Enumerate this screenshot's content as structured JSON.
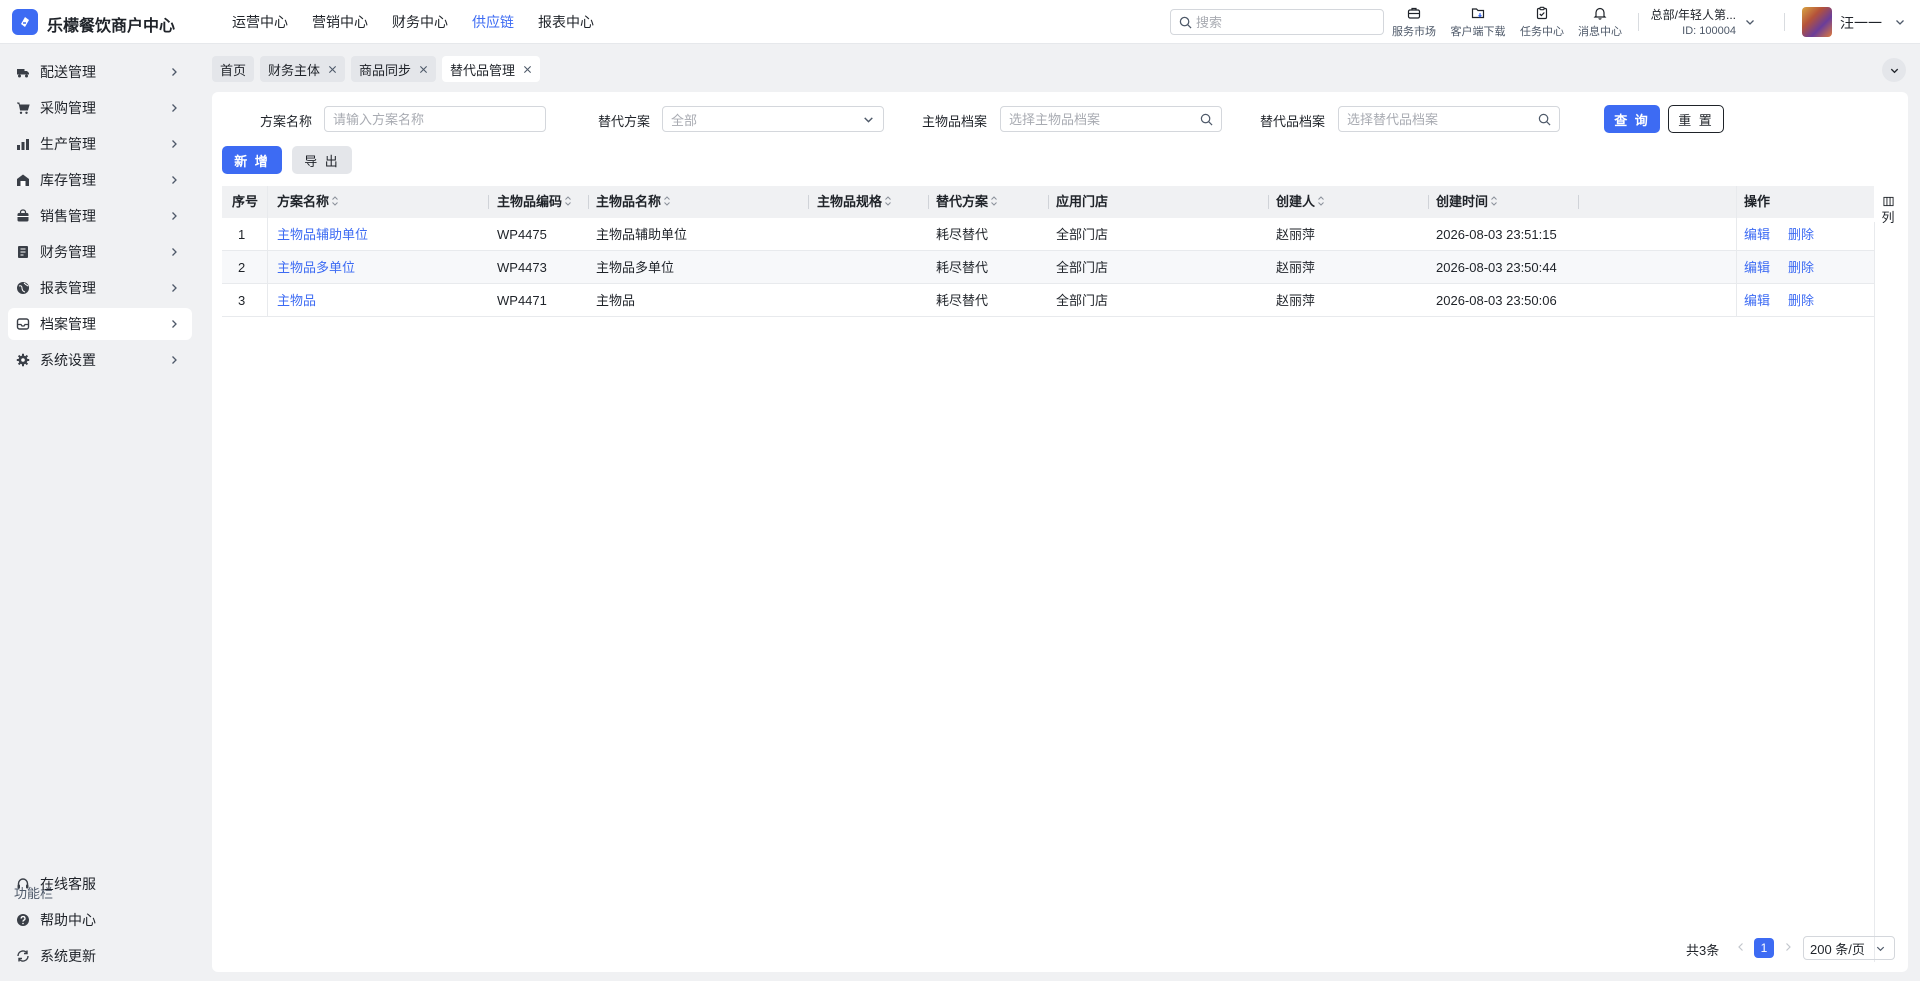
{
  "app": {
    "title": "乐檬餐饮商户中心",
    "top_nav": [
      {
        "label": "运营中心"
      },
      {
        "label": "营销中心"
      },
      {
        "label": "财务中心"
      },
      {
        "label": "供应链",
        "active": true
      },
      {
        "label": "报表中心"
      }
    ],
    "search_placeholder": "搜索",
    "tools": [
      {
        "label": "服务市场",
        "icon": "briefcase-icon"
      },
      {
        "label": "客户端下载",
        "icon": "folder-download-icon"
      },
      {
        "label": "任务中心",
        "icon": "clipboard-icon"
      },
      {
        "label": "消息中心",
        "icon": "bell-icon"
      }
    ],
    "org_name": "总部/年轻人第...",
    "org_id": "ID: 100004",
    "username": "汪一一"
  },
  "sidebar": {
    "items": [
      {
        "label": "配送管理",
        "icon": "truck-icon"
      },
      {
        "label": "采购管理",
        "icon": "cart-icon"
      },
      {
        "label": "生产管理",
        "icon": "factory-icon"
      },
      {
        "label": "库存管理",
        "icon": "warehouse-icon"
      },
      {
        "label": "销售管理",
        "icon": "bag-icon"
      },
      {
        "label": "财务管理",
        "icon": "ledger-icon"
      },
      {
        "label": "报表管理",
        "icon": "globe-icon"
      },
      {
        "label": "档案管理",
        "icon": "archive-icon",
        "active": true
      },
      {
        "label": "系统设置",
        "icon": "gear-icon"
      }
    ],
    "func_title": "功能栏",
    "func_items": [
      {
        "label": "在线客服",
        "icon": "headset-icon"
      },
      {
        "label": "帮助中心",
        "icon": "help-icon"
      },
      {
        "label": "系统更新",
        "icon": "refresh-icon"
      }
    ]
  },
  "tabs": [
    {
      "label": "首页",
      "closable": false
    },
    {
      "label": "财务主体",
      "closable": true
    },
    {
      "label": "商品同步",
      "closable": true
    },
    {
      "label": "替代品管理",
      "closable": true,
      "active": true
    }
  ],
  "filters": {
    "plan_name_label": "方案名称",
    "plan_name_placeholder": "请输入方案名称",
    "plan_type_label": "替代方案",
    "plan_type_value": "全部",
    "main_item_label": "主物品档案",
    "main_item_placeholder": "选择主物品档案",
    "sub_item_label": "替代品档案",
    "sub_item_placeholder": "选择替代品档案",
    "query_label": "查 询",
    "reset_label": "重 置"
  },
  "actions": {
    "add_label": "新 增",
    "export_label": "导 出"
  },
  "table": {
    "columns": {
      "index": "序号",
      "plan_name": "方案名称",
      "main_code": "主物品编码",
      "main_name": "主物品名称",
      "main_spec": "主物品规格",
      "plan_type": "替代方案",
      "store": "应用门店",
      "creator": "创建人",
      "created_at": "创建时间",
      "ops": "操作"
    },
    "rows": [
      {
        "index": "1",
        "plan_name": "主物品辅助单位",
        "main_code": "WP4475",
        "main_name": "主物品辅助单位",
        "main_spec": "",
        "plan_type": "耗尽替代",
        "store": "全部门店",
        "creator": "赵丽萍",
        "created_at": "2026-08-03 23:51:15",
        "edit": "编辑",
        "delete": "删除"
      },
      {
        "index": "2",
        "plan_name": "主物品多单位",
        "main_code": "WP4473",
        "main_name": "主物品多单位",
        "main_spec": "",
        "plan_type": "耗尽替代",
        "store": "全部门店",
        "creator": "赵丽萍",
        "created_at": "2026-08-03 23:50:44",
        "edit": "编辑",
        "delete": "删除"
      },
      {
        "index": "3",
        "plan_name": "主物品",
        "main_code": "WP4471",
        "main_name": "主物品",
        "main_spec": "",
        "plan_type": "耗尽替代",
        "store": "全部门店",
        "creator": "赵丽萍",
        "created_at": "2026-08-03 23:50:06",
        "edit": "编辑",
        "delete": "删除"
      }
    ],
    "column_config_label": "列"
  },
  "pagination": {
    "total": "共3条",
    "current_page": "1",
    "page_size": "200 条/页"
  },
  "colors": {
    "accent": "#3d6bf3",
    "sidebar_bg": "#f0f1f3",
    "text": "#1f2329"
  }
}
